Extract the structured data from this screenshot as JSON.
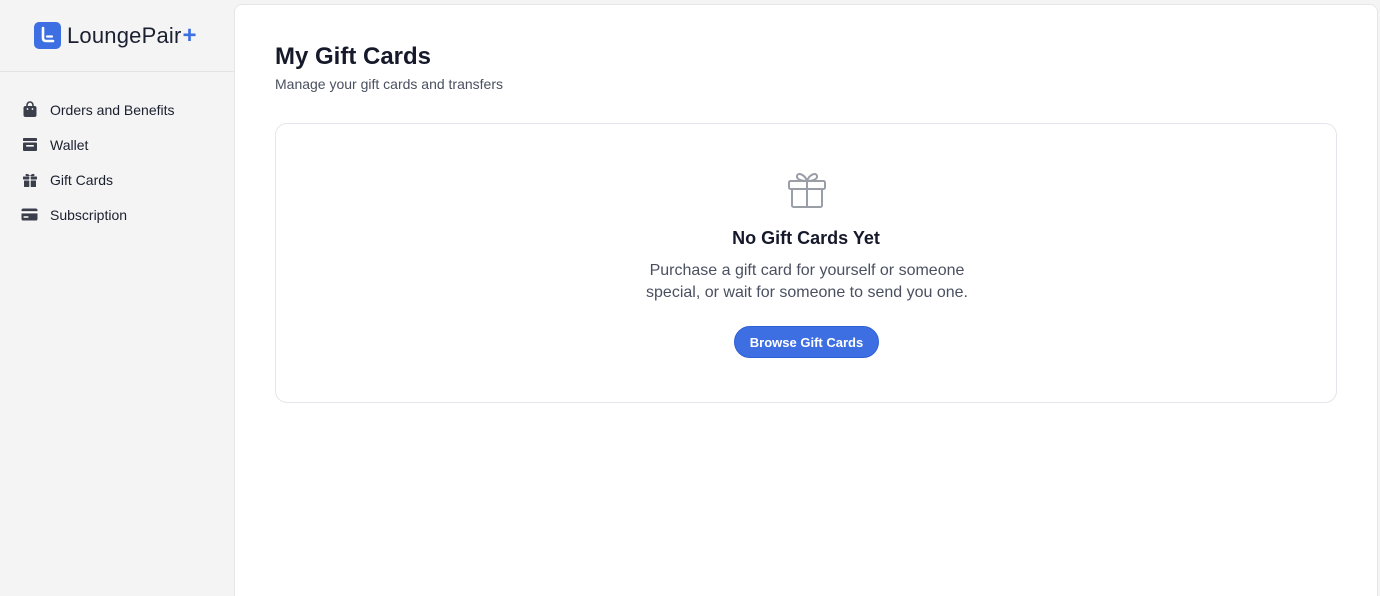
{
  "brand": {
    "name": "LoungePair",
    "plus": "+",
    "accent_color": "#3d6fe3"
  },
  "sidebar": {
    "items": [
      {
        "label": "Orders and Benefits",
        "icon": "shopping-bag-icon"
      },
      {
        "label": "Wallet",
        "icon": "wallet-icon"
      },
      {
        "label": "Gift Cards",
        "icon": "gift-icon"
      },
      {
        "label": "Subscription",
        "icon": "credit-card-icon"
      }
    ]
  },
  "main": {
    "title": "My Gift Cards",
    "subtitle": "Manage your gift cards and transfers",
    "empty_state": {
      "icon": "gift-icon",
      "title": "No Gift Cards Yet",
      "text": "Purchase a gift card for yourself or someone special, or wait for someone to send you one.",
      "button_label": "Browse Gift Cards"
    }
  }
}
